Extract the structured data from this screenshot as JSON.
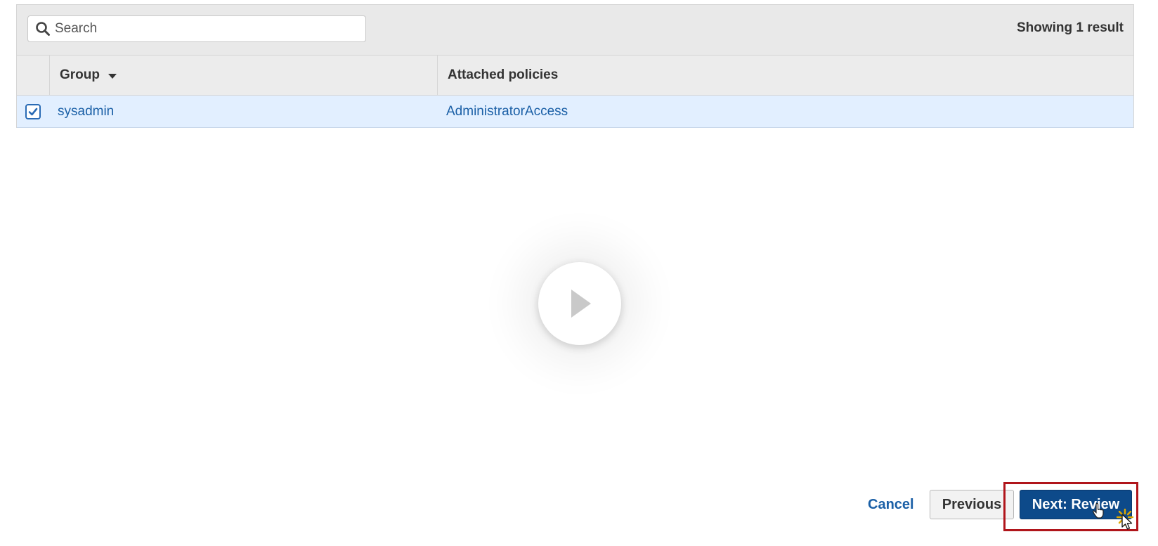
{
  "search": {
    "placeholder": "Search",
    "value": ""
  },
  "results": {
    "count_text": "Showing 1 result"
  },
  "table": {
    "columns": {
      "group": "Group",
      "policies": "Attached policies"
    },
    "rows": [
      {
        "checked": true,
        "group": "sysadmin",
        "policies": "AdministratorAccess"
      }
    ]
  },
  "footer": {
    "cancel_label": "Cancel",
    "previous_label": "Previous",
    "next_label": "Next: Review"
  },
  "icons": {
    "search": "search-icon",
    "sort": "caret-down-icon",
    "check": "checkmark-icon",
    "play": "play-icon",
    "cursor": "hand-pointer-icon"
  },
  "colors": {
    "link": "#1a5fa6",
    "selected_row": "#e2efff",
    "primary_button": "#0d4a8a",
    "highlight": "#b0151b"
  }
}
